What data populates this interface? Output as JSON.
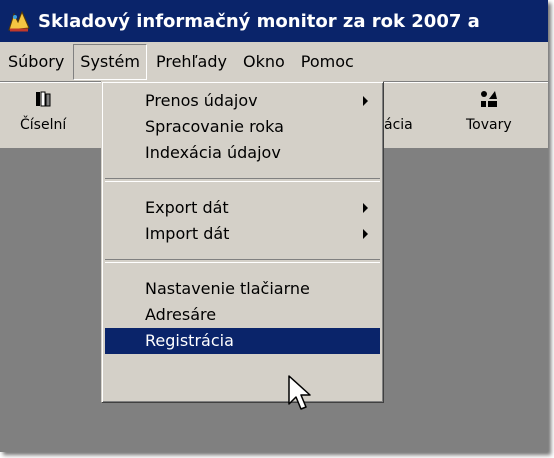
{
  "window": {
    "title": "Skladový informačný monitor za rok 2007 a"
  },
  "menubar": {
    "items": [
      {
        "label": "Súbory"
      },
      {
        "label": "Systém"
      },
      {
        "label": "Prehľady"
      },
      {
        "label": "Okno"
      },
      {
        "label": "Pomoc"
      }
    ],
    "active": "Systém"
  },
  "toolbar": {
    "buttons": [
      {
        "label": "Číselní",
        "icon": "books-icon"
      },
      {
        "label": "ácia",
        "icon": "toolbar-icon"
      },
      {
        "label": "Tovary",
        "icon": "goods-icon"
      }
    ]
  },
  "dropdown": {
    "items": [
      {
        "label": "Prenos údajov",
        "submenu": true
      },
      {
        "label": "Spracovanie roka",
        "submenu": false
      },
      {
        "label": "Indexácia údajov",
        "submenu": false
      },
      {
        "label": "Export dát",
        "submenu": true
      },
      {
        "label": "Import dát",
        "submenu": true
      },
      {
        "label": "Nastavenie tlačiarne",
        "submenu": false
      },
      {
        "label": "Adresáre",
        "submenu": false
      },
      {
        "label": "Registrácia",
        "submenu": false,
        "highlighted": true
      }
    ]
  },
  "colors": {
    "titlebar": "#0a246a",
    "face": "#d4d0c8",
    "workspace": "#808080",
    "highlight": "#0a246a"
  }
}
